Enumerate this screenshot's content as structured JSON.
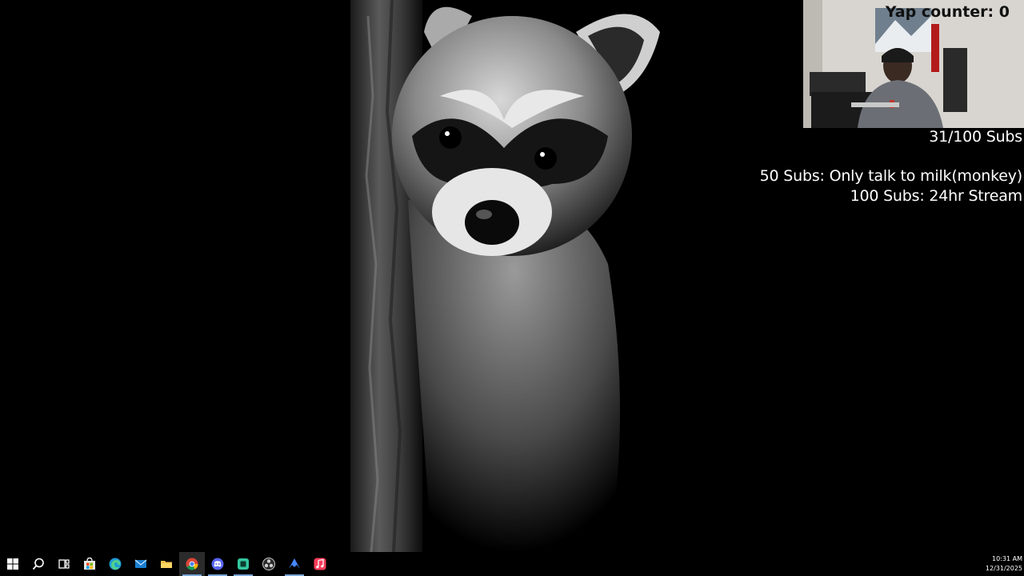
{
  "overlay": {
    "yap_counter": "Yap counter: 0",
    "subs_count": "31/100 Subs",
    "goal_50": "50 Subs: Only talk to milk(monkey)",
    "goal_100": "100 Subs: 24hr Stream"
  },
  "taskbar": {
    "items": [
      {
        "name": "start-button",
        "icon": "windows-logo-icon"
      },
      {
        "name": "search-button",
        "icon": "search-icon"
      },
      {
        "name": "task-view-button",
        "icon": "task-view-icon"
      },
      {
        "name": "microsoft-store-button",
        "icon": "store-icon"
      },
      {
        "name": "edge-button",
        "icon": "edge-icon"
      },
      {
        "name": "mail-button",
        "icon": "mail-icon"
      },
      {
        "name": "file-explorer-button",
        "icon": "folder-icon"
      },
      {
        "name": "chrome-button",
        "icon": "chrome-icon"
      },
      {
        "name": "discord-button",
        "icon": "discord-icon"
      },
      {
        "name": "green-app-button",
        "icon": "app-icon"
      },
      {
        "name": "obs-button",
        "icon": "obs-icon"
      },
      {
        "name": "nordvpn-button",
        "icon": "vpn-icon"
      },
      {
        "name": "itunes-button",
        "icon": "music-icon"
      }
    ],
    "colors": {
      "windows": "#ffffff",
      "edge": "#1f9bd6",
      "mail": "#1a7fd0",
      "folder": "#f3c24b",
      "discord": "#5865f2",
      "green_app": "#34c7a0",
      "nordvpn": "#4687ff",
      "itunes": "#fa3c5a"
    }
  },
  "clock": {
    "time": "10:31 AM",
    "date": "12/31/2025"
  }
}
